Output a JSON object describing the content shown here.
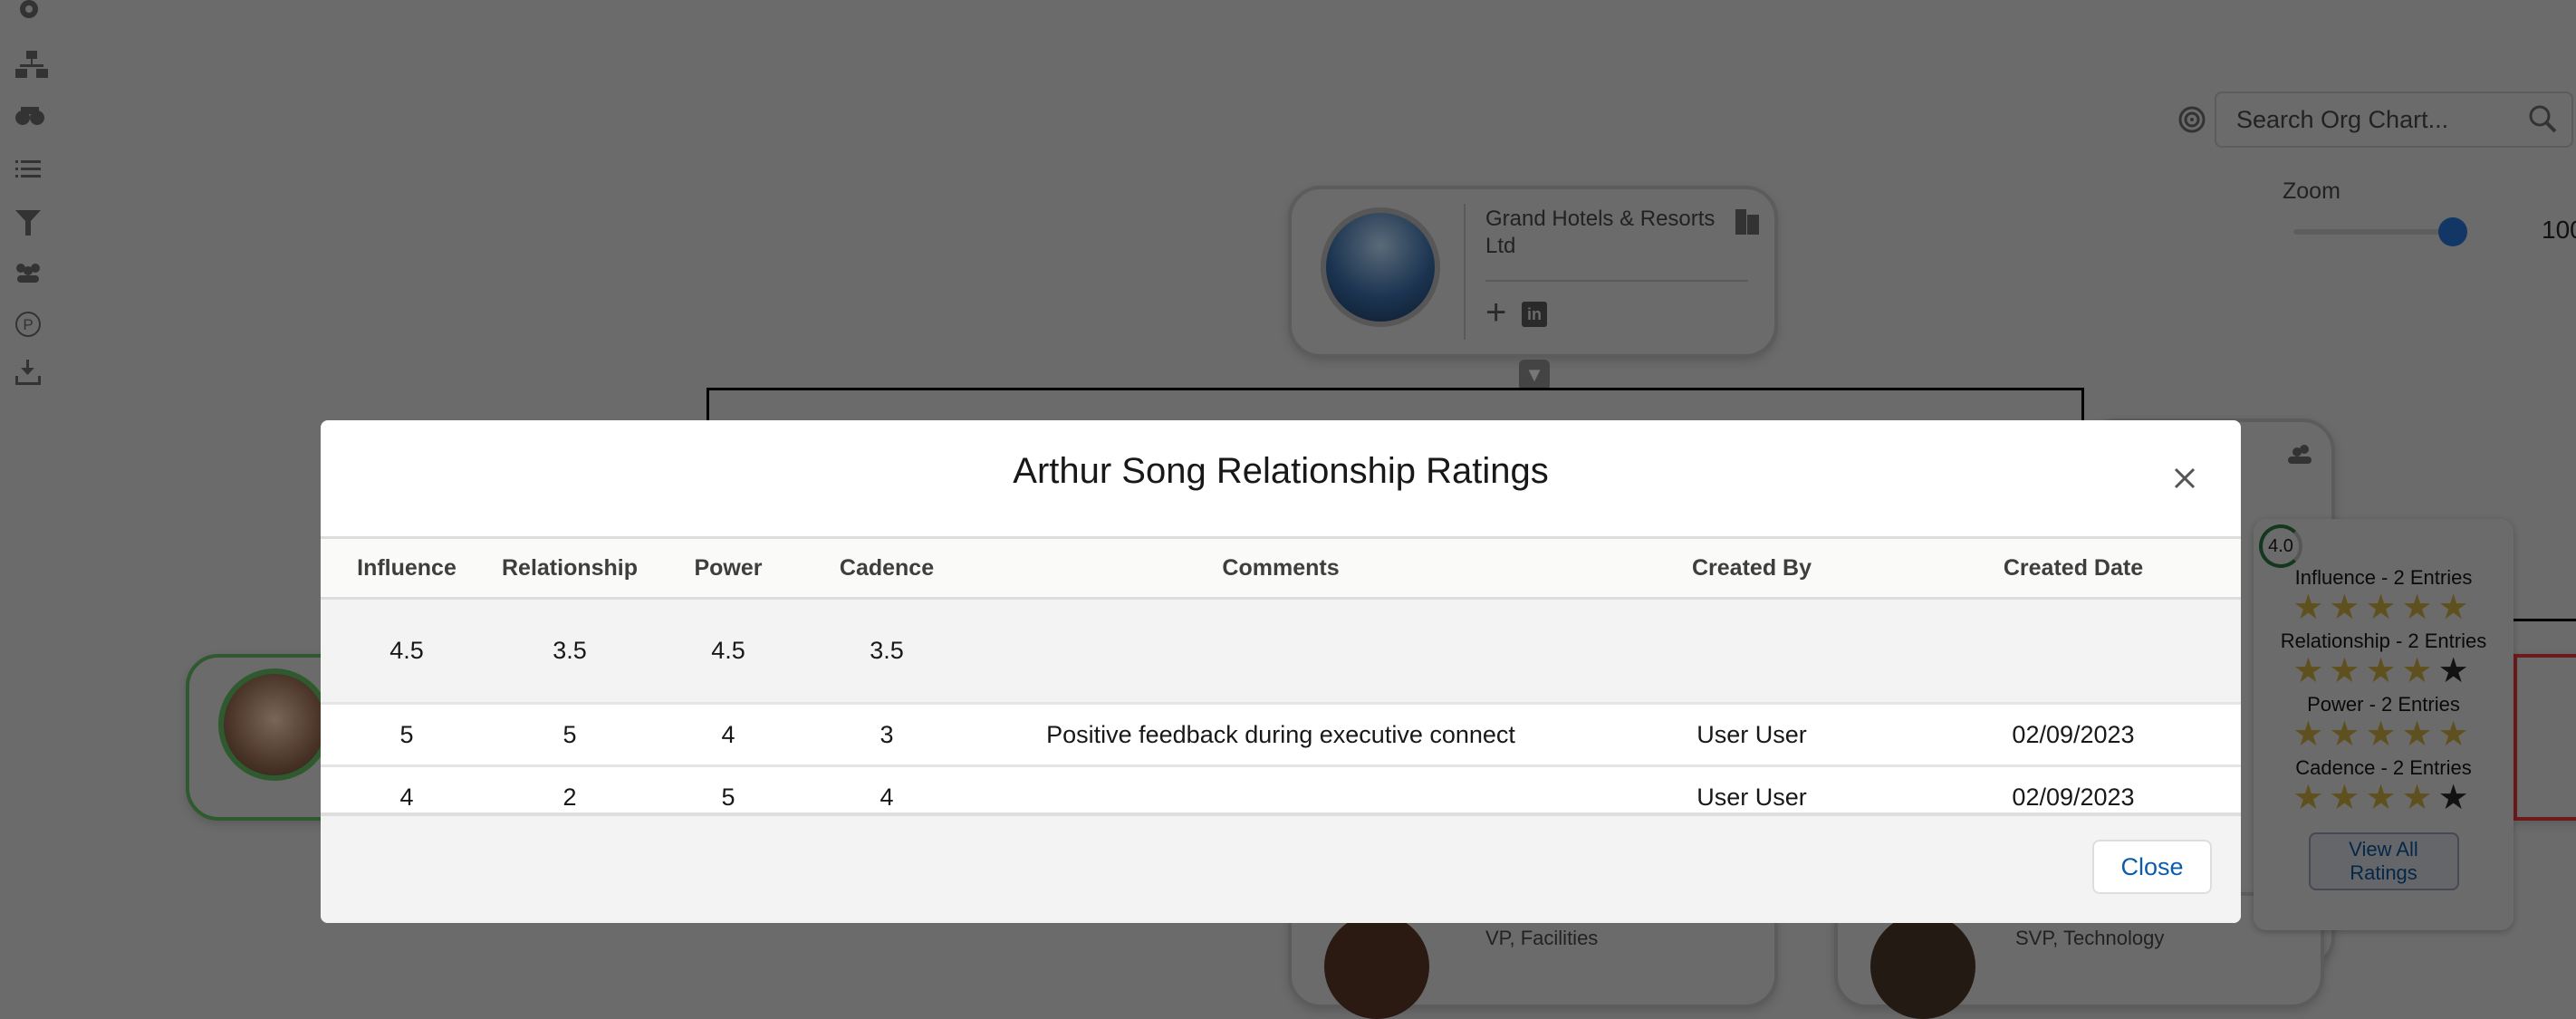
{
  "sidebar": {
    "icons": [
      "gear-icon",
      "hierarchy-icon",
      "binoculars-icon",
      "list-icon",
      "filter-icon",
      "team-icon",
      "p-circle-icon",
      "download-icon"
    ]
  },
  "search": {
    "placeholder": "Search Org Chart..."
  },
  "zoom": {
    "label": "Zoom",
    "value_text": "100",
    "level_percent": 100
  },
  "company_card": {
    "name": "Grand Hotels & Resorts Ltd"
  },
  "bottom_cards": [
    {
      "title": "VP, Facilities"
    },
    {
      "title": "SVP, Technology"
    }
  ],
  "modal": {
    "title": "Arthur Song Relationship Ratings",
    "columns": [
      "Influence",
      "Relationship",
      "Power",
      "Cadence",
      "Comments",
      "Created By",
      "Created Date"
    ],
    "average": [
      "4.5",
      "3.5",
      "4.5",
      "3.5",
      "",
      "",
      ""
    ],
    "rows": [
      [
        "5",
        "5",
        "4",
        "3",
        "Positive feedback during executive connect",
        "User User",
        "02/09/2023"
      ],
      [
        "4",
        "2",
        "5",
        "4",
        "",
        "User User",
        "02/09/2023"
      ]
    ],
    "close_label": "Close"
  },
  "ratings_popover": {
    "score": "4.0",
    "categories": [
      {
        "label": "Influence - 2 Entries",
        "stars": 5
      },
      {
        "label": "Relationship - 2 Entries",
        "stars": 4
      },
      {
        "label": "Power - 2 Entries",
        "stars": 5
      },
      {
        "label": "Cadence - 2 Entries",
        "stars": 4
      }
    ],
    "view_all_label": "View All Ratings"
  },
  "colors": {
    "accent": "#0b5cab",
    "star": "#e2c04a",
    "positive_ring": "#2e844a",
    "negative_ring": "#ba0517"
  }
}
